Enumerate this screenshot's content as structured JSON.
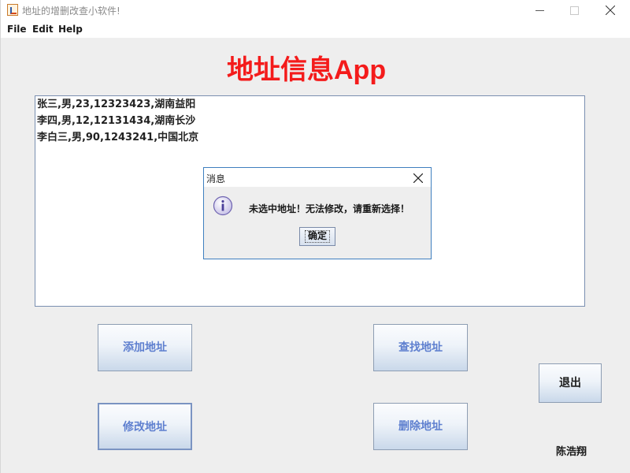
{
  "window": {
    "title": "地址的增删改查小软件!",
    "icon": "java-cup-icon"
  },
  "menu": {
    "items": [
      "File",
      "Edit",
      "Help"
    ]
  },
  "header": {
    "title": "地址信息App",
    "title_color": "#f41b1b"
  },
  "addresses": [
    "张三,男,23,12323423,湖南益阳",
    "李四,男,12,12131434,湖南长沙",
    "李白三,男,90,1243241,中国北京"
  ],
  "dialog": {
    "title": "消息",
    "icon": "info-icon",
    "message": "未选中地址！无法修改，请重新选择！",
    "ok_label": "确定"
  },
  "buttons": {
    "add": "添加地址",
    "find": "查找地址",
    "edit": "修改地址",
    "delete": "删除地址",
    "exit": "退出"
  },
  "author": "陈浩翔"
}
